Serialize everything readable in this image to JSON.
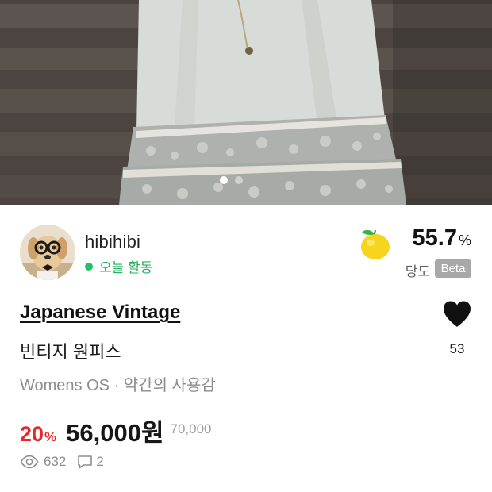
{
  "photo": {
    "alt_description_shown": false,
    "pager": {
      "total": 2,
      "current": 1
    }
  },
  "seller": {
    "name": "hibihibi",
    "activity": "오늘 활동"
  },
  "sweetness": {
    "value": "55.7",
    "unit": "%",
    "label": "당도",
    "badge": "Beta",
    "icon": "yellow-fruit-icon"
  },
  "product": {
    "brand": "Japanese Vintage",
    "title": "빈티지 원피스",
    "category": "Womens OS",
    "separator": "·",
    "condition": "약간의 사용감",
    "discount": "20",
    "discount_unit": "%",
    "price": "56,000원",
    "original_price": "70,000"
  },
  "like": {
    "count": "53",
    "icon": "heart-icon"
  },
  "stats": {
    "views": "632",
    "comments": "2"
  },
  "colors": {
    "discount": "#e52a2f",
    "active_green": "#20b15a",
    "beta_badge": "#a8a8a8"
  }
}
